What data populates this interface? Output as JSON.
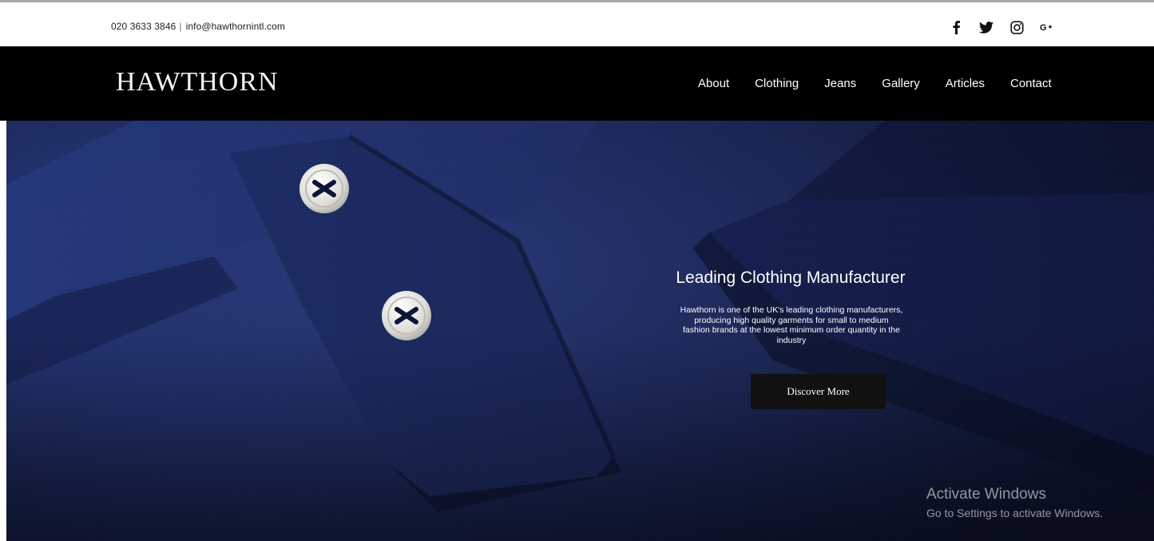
{
  "topbar": {
    "phone": "020 3633 3846",
    "separator": "|",
    "email": "info@hawthornintl.com",
    "social": [
      {
        "name": "facebook-icon",
        "glyph": "f"
      },
      {
        "name": "twitter-icon",
        "glyph": "twitter"
      },
      {
        "name": "instagram-icon",
        "glyph": "instagram"
      },
      {
        "name": "google-plus-icon",
        "glyph": "G+"
      }
    ]
  },
  "header": {
    "logo": "HAWTHORN",
    "nav": [
      "About",
      "Clothing",
      "Jeans",
      "Gallery",
      "Articles",
      "Contact"
    ]
  },
  "hero": {
    "title": "Leading Clothing Manufacturer",
    "text": "Hawthorn is one of the UK's leading clothing manufacturers, producing high quality garments for small to medium fashion brands at the lowest minimum order quantity in the industry",
    "button": "Discover More"
  },
  "watermark": {
    "title": "Activate Windows",
    "subtitle": "Go to Settings to activate Windows."
  },
  "colors": {
    "navbar": "#000000",
    "hero_fabric": "#1c2a5f",
    "button": "#111111"
  }
}
